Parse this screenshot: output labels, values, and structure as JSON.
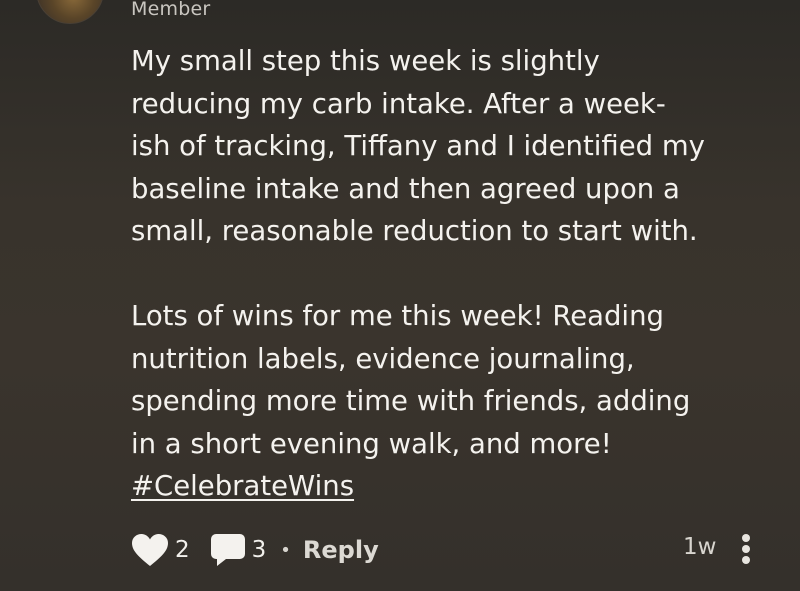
{
  "author": {
    "role": "Member"
  },
  "post": {
    "paragraph1": "My small step this week is slightly\nreducing my carb intake.  After a week-\nish of tracking, Tiffany and I identified my\nbaseline intake and then agreed upon a\nsmall, reasonable reduction to start with.",
    "paragraph2": "Lots of wins for me this week!  Reading\nnutrition labels, evidence journaling,\nspending more time with friends, adding\nin a short evening walk, and more!",
    "hashtag": "#CelebrateWins"
  },
  "actions": {
    "likes_count": "2",
    "comments_count": "3",
    "separator": "•",
    "reply_label": "Reply",
    "timestamp": "1w",
    "icons": [
      "heart-icon",
      "comment-icon",
      "more-vertical-icon"
    ]
  },
  "colors": {
    "text": "#f4f2ee",
    "muted": "#c9c6c0",
    "background": "#38332c"
  }
}
